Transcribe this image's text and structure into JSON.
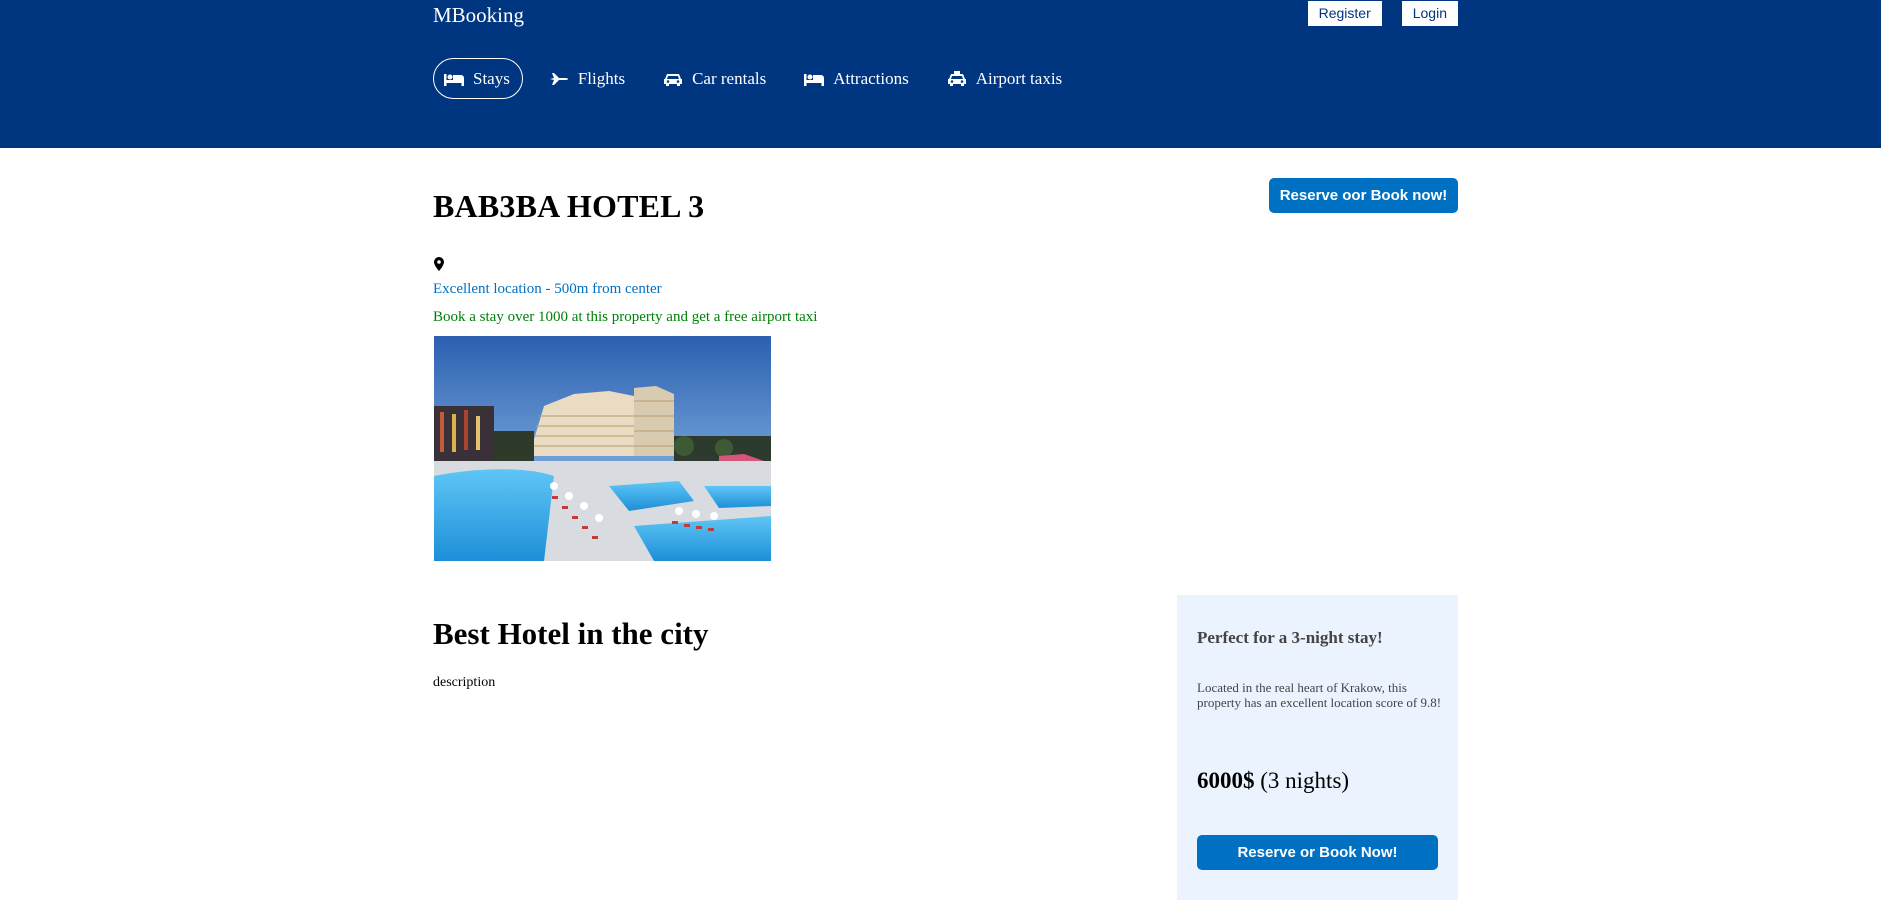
{
  "header": {
    "brand": "MBooking",
    "register_label": "Register",
    "login_label": "Login",
    "background": "#003580",
    "nav": [
      {
        "label": "Stays",
        "icon": "bed-icon",
        "active": true
      },
      {
        "label": "Flights",
        "icon": "plane-icon",
        "active": false
      },
      {
        "label": "Car rentals",
        "icon": "car-icon",
        "active": false
      },
      {
        "label": "Attractions",
        "icon": "bed-icon",
        "active": false
      },
      {
        "label": "Airport taxis",
        "icon": "taxi-icon",
        "active": false
      }
    ]
  },
  "hotel": {
    "name": "BAB3BA HOTEL 3",
    "reserve_label": "Reserve oor Book now!",
    "location_icon": "map-pin-icon",
    "location_text": "Excellent location - 500m from center",
    "promo_text": "Book a stay over 1000 at this property and get a free airport taxi",
    "image_alt": "hotel-photo"
  },
  "details": {
    "title": "Best Hotel in the city",
    "description": "description"
  },
  "side_panel": {
    "heading": "Perfect for a 3-night stay!",
    "text": "Located in the real heart of Krakow, this property has an excellent location score of 9.8!",
    "price": "6000$",
    "nights": "(3 nights)",
    "reserve_label": "Reserve or Book Now!"
  },
  "colors": {
    "primary_blue": "#0071c2",
    "promo_green": "#008009",
    "panel_bg": "#ebf3ff"
  }
}
